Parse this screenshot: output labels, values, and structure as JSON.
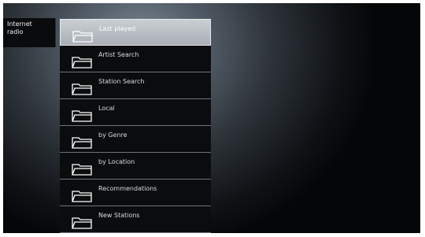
{
  "side": {
    "label": "Internet\nradio"
  },
  "menu": {
    "items": [
      {
        "label": "Last played",
        "icon": "folder-icon",
        "selected": true
      },
      {
        "label": "Artist Search",
        "icon": "folder-icon"
      },
      {
        "label": "Station Search",
        "icon": "folder-icon"
      },
      {
        "label": "Local",
        "icon": "folder-icon"
      },
      {
        "label": "by Genre",
        "icon": "folder-icon"
      },
      {
        "label": "by Location",
        "icon": "folder-icon"
      },
      {
        "label": "Recommendations",
        "icon": "folder-icon"
      },
      {
        "label": "New Stations",
        "icon": "folder-icon"
      }
    ]
  },
  "colors": {
    "selected_bg": "#b8bec3",
    "item_bg": "#0b0c0e",
    "text": "#d8dde1"
  }
}
